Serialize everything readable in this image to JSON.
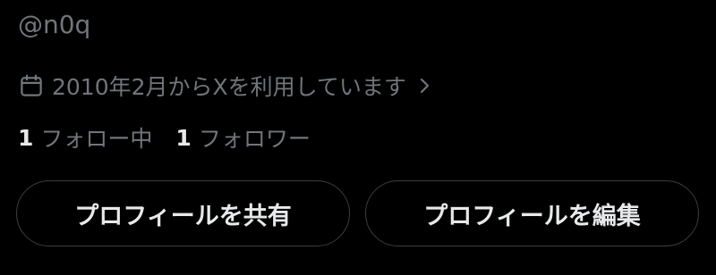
{
  "profile": {
    "handle": "@n0q",
    "joined_text": "2010年2月からXを利用しています",
    "following_count": "1",
    "following_label": "フォロー中",
    "followers_count": "1",
    "followers_label": "フォロワー"
  },
  "actions": {
    "share_label": "プロフィールを共有",
    "edit_label": "プロフィールを編集"
  },
  "icons": {
    "joined": "calendar-icon",
    "joined_more": "chevron-right-icon"
  },
  "colors": {
    "background": "#000000",
    "primary_text": "#e7e9ea",
    "secondary_text": "#71767b",
    "button_border": "#3a3d41"
  }
}
